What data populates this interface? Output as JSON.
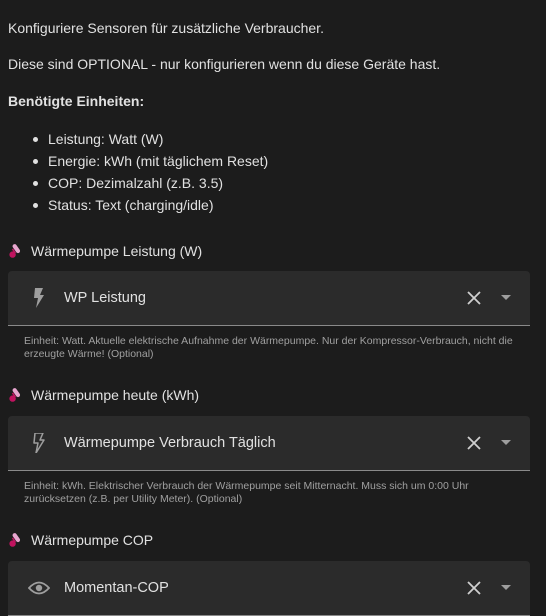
{
  "intro": {
    "line1": "Konfiguriere Sensoren für zusätzliche Verbraucher.",
    "line2": "Diese sind OPTIONAL - nur konfigurieren wenn du diese Geräte hast.",
    "units_heading": "Benötigte Einheiten:",
    "units": [
      "Leistung: Watt (W)",
      "Energie: kWh (mit täglichem Reset)",
      "COP: Dezimalzahl (z.B. 3.5)",
      "Status: Text (charging/idle)"
    ]
  },
  "fields": [
    {
      "label": "Wärmepumpe Leistung (W)",
      "label_icon": "thermometer-icon",
      "entity_icon": "flash-icon",
      "value": "WP Leistung",
      "helper": "Einheit: Watt. Aktuelle elektrische Aufnahme der Wärmepumpe. Nur der Kompressor-Verbrauch, nicht die erzeugte Wärme! (Optional)"
    },
    {
      "label": "Wärmepumpe heute (kWh)",
      "label_icon": "thermometer-icon",
      "entity_icon": "flash-outline-icon",
      "value": "Wärmepumpe Verbrauch Täglich",
      "helper": "Einheit: kWh. Elektrischer Verbrauch der Wärmepumpe seit Mitternacht. Muss sich um 0:00 Uhr zurücksetzen (z.B. per Utility Meter). (Optional)"
    },
    {
      "label": "Wärmepumpe COP",
      "label_icon": "thermometer-icon",
      "entity_icon": "eye-icon",
      "value": "Momentan-COP"
    }
  ],
  "colors": {
    "background": "#1c1c1c",
    "field_background": "#2b2b2b",
    "text": "#e1e1e1",
    "helper_text": "#a0a0a0",
    "icon": "#9e9e9e",
    "thermometer_body": "#e8a6cf",
    "thermometer_bulb": "#c0135f"
  }
}
